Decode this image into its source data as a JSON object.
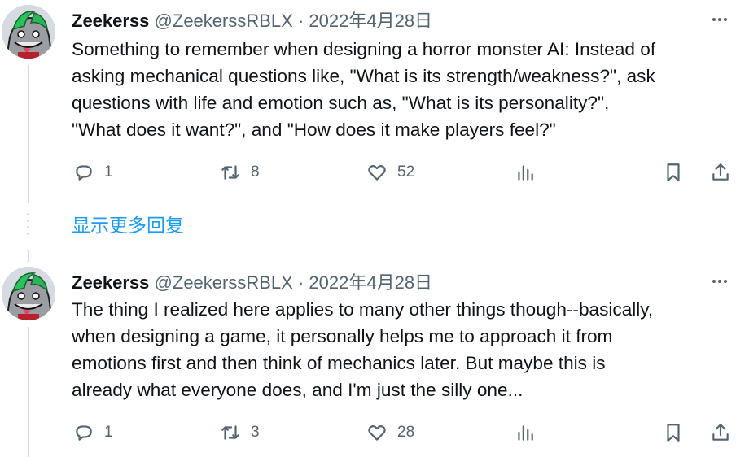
{
  "tweets": [
    {
      "author": {
        "name": "Zeekerss",
        "handle": "@ZeekerssRBLX"
      },
      "separator": "·",
      "date": "2022年4月28日",
      "text": "Something to remember when designing a horror monster AI: Instead of\nasking mechanical questions like, \"What is its strength/weakness?\", ask\nquestions with life and emotion such as, \"What is its personality?\",\n\"What does it want?\", and \"How does it make players feel?\"",
      "stats": {
        "replies": "1",
        "retweets": "8",
        "likes": "52"
      }
    },
    {
      "author": {
        "name": "Zeekerss",
        "handle": "@ZeekerssRBLX"
      },
      "separator": "·",
      "date": "2022年4月28日",
      "text": "The thing I realized here applies to many other things though--basically,\nwhen designing a game, it personally helps me to approach it from\nemotions first and then think of mechanics later. But maybe this is\nalready what everyone does, and I'm just the silly one...",
      "stats": {
        "replies": "1",
        "retweets": "3",
        "likes": "28"
      }
    }
  ],
  "show_more_replies": "显示更多回复",
  "icons": [
    "reply-icon",
    "retweet-icon",
    "like-icon",
    "views-icon",
    "bookmark-icon",
    "share-icon",
    "more-icon"
  ],
  "colors": {
    "text": "#0f1419",
    "secondary": "#536471",
    "link": "#1d9bf0",
    "thread_line": "#cfd9de"
  }
}
